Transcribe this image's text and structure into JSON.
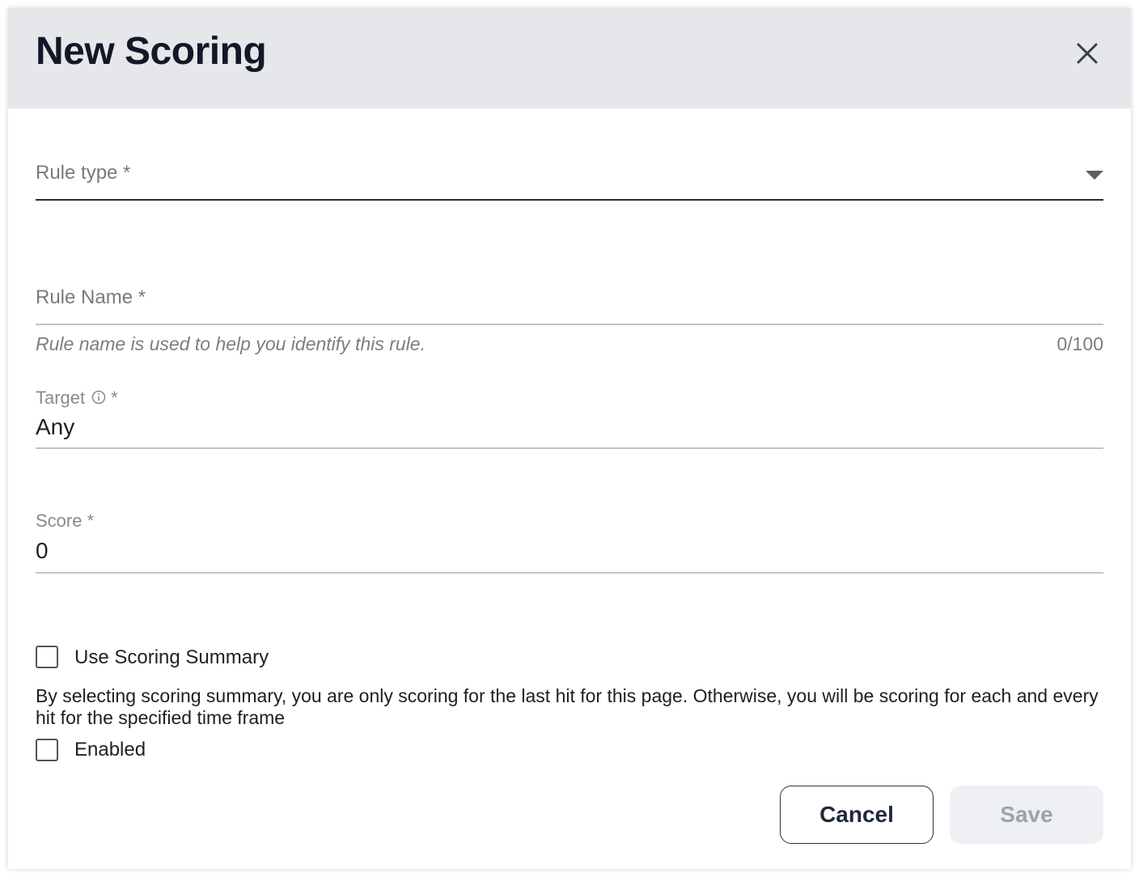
{
  "dialog": {
    "title": "New Scoring"
  },
  "rule_type": {
    "label": "Rule type *"
  },
  "rule_name": {
    "label": "Rule Name *",
    "helper": "Rule name is used to help you identify this rule.",
    "counter": "0/100",
    "value": ""
  },
  "target": {
    "label": "Target",
    "required_mark": "*",
    "value": "Any"
  },
  "score": {
    "label": "Score *",
    "value": "0"
  },
  "scoring_summary": {
    "label": "Use Scoring Summary",
    "checked": false,
    "description": "By selecting scoring summary, you are only scoring for the last hit for this page. Otherwise, you will be scoring for each and every hit for the specified time frame"
  },
  "enabled": {
    "label": "Enabled",
    "checked": false
  },
  "buttons": {
    "cancel": "Cancel",
    "save": "Save"
  },
  "icons": {
    "close": "close-icon",
    "dropdown": "caret-down-icon",
    "info": "info-icon"
  }
}
